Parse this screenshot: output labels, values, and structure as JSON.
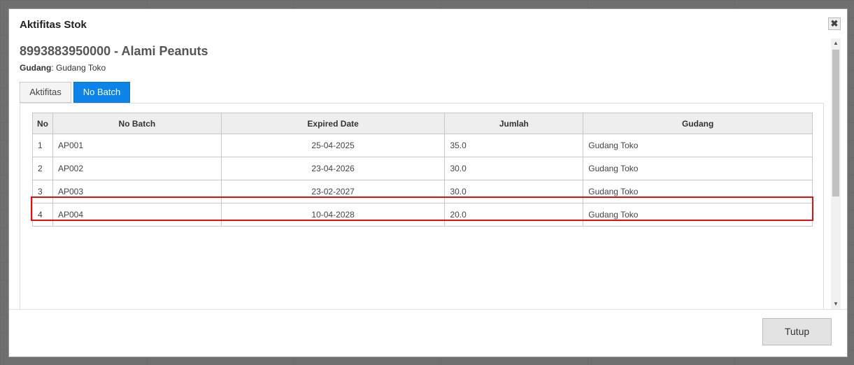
{
  "modal": {
    "title": "Aktifitas Stok",
    "close_symbol": "✖"
  },
  "product": {
    "heading": "8993883950000 - Alami Peanuts",
    "warehouse_label": "Gudang",
    "warehouse_value": ": Gudang Toko"
  },
  "tabs": [
    {
      "label": "Aktifitas",
      "active": false
    },
    {
      "label": "No Batch",
      "active": true
    }
  ],
  "table": {
    "headers": [
      "No",
      "No Batch",
      "Expired Date",
      "Jumlah",
      "Gudang"
    ],
    "rows": [
      [
        "1",
        "AP001",
        "25-04-2025",
        "35.0",
        "Gudang Toko"
      ],
      [
        "2",
        "AP002",
        "23-04-2026",
        "30.0",
        "Gudang Toko"
      ],
      [
        "3",
        "AP003",
        "23-02-2027",
        "30.0",
        "Gudang Toko"
      ],
      [
        "4",
        "AP004",
        "10-04-2028",
        "20.0",
        "Gudang Toko"
      ]
    ]
  },
  "scrollbar": {
    "up": "▲",
    "down": "▼"
  },
  "footer": {
    "close_label": "Tutup"
  },
  "colors": {
    "active_tab": "#0d84ea",
    "highlight": "#e01010"
  }
}
